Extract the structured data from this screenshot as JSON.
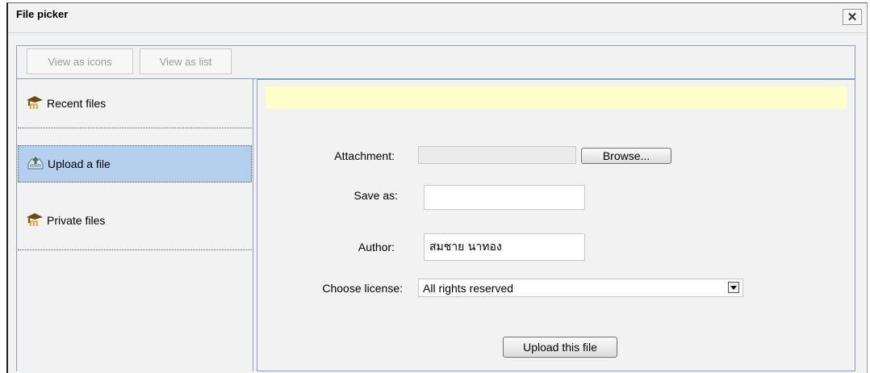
{
  "window": {
    "title": "File picker",
    "close_symbol": "✕"
  },
  "toolbar": {
    "view_icons_label": "View as icons",
    "view_list_label": "View as list"
  },
  "sidebar": {
    "items": [
      {
        "label": "Recent files",
        "icon": "moodle-m-icon",
        "selected": false
      },
      {
        "label": "Upload a file",
        "icon": "upload-icon",
        "selected": true
      },
      {
        "label": "Private files",
        "icon": "moodle-m-icon",
        "selected": false
      }
    ]
  },
  "form": {
    "attachment_label": "Attachment:",
    "attachment_value": "",
    "browse_label": "Browse...",
    "save_as_label": "Save as:",
    "save_as_value": "",
    "author_label": "Author:",
    "author_value": "สมชาย นาทอง",
    "license_label": "Choose license:",
    "license_value": "All rights reserved",
    "upload_label": "Upload this file"
  },
  "colors": {
    "selected_bg": "#b5cfef",
    "notice_bg": "#ffffcc",
    "panel_border": "#8aa0b8"
  }
}
